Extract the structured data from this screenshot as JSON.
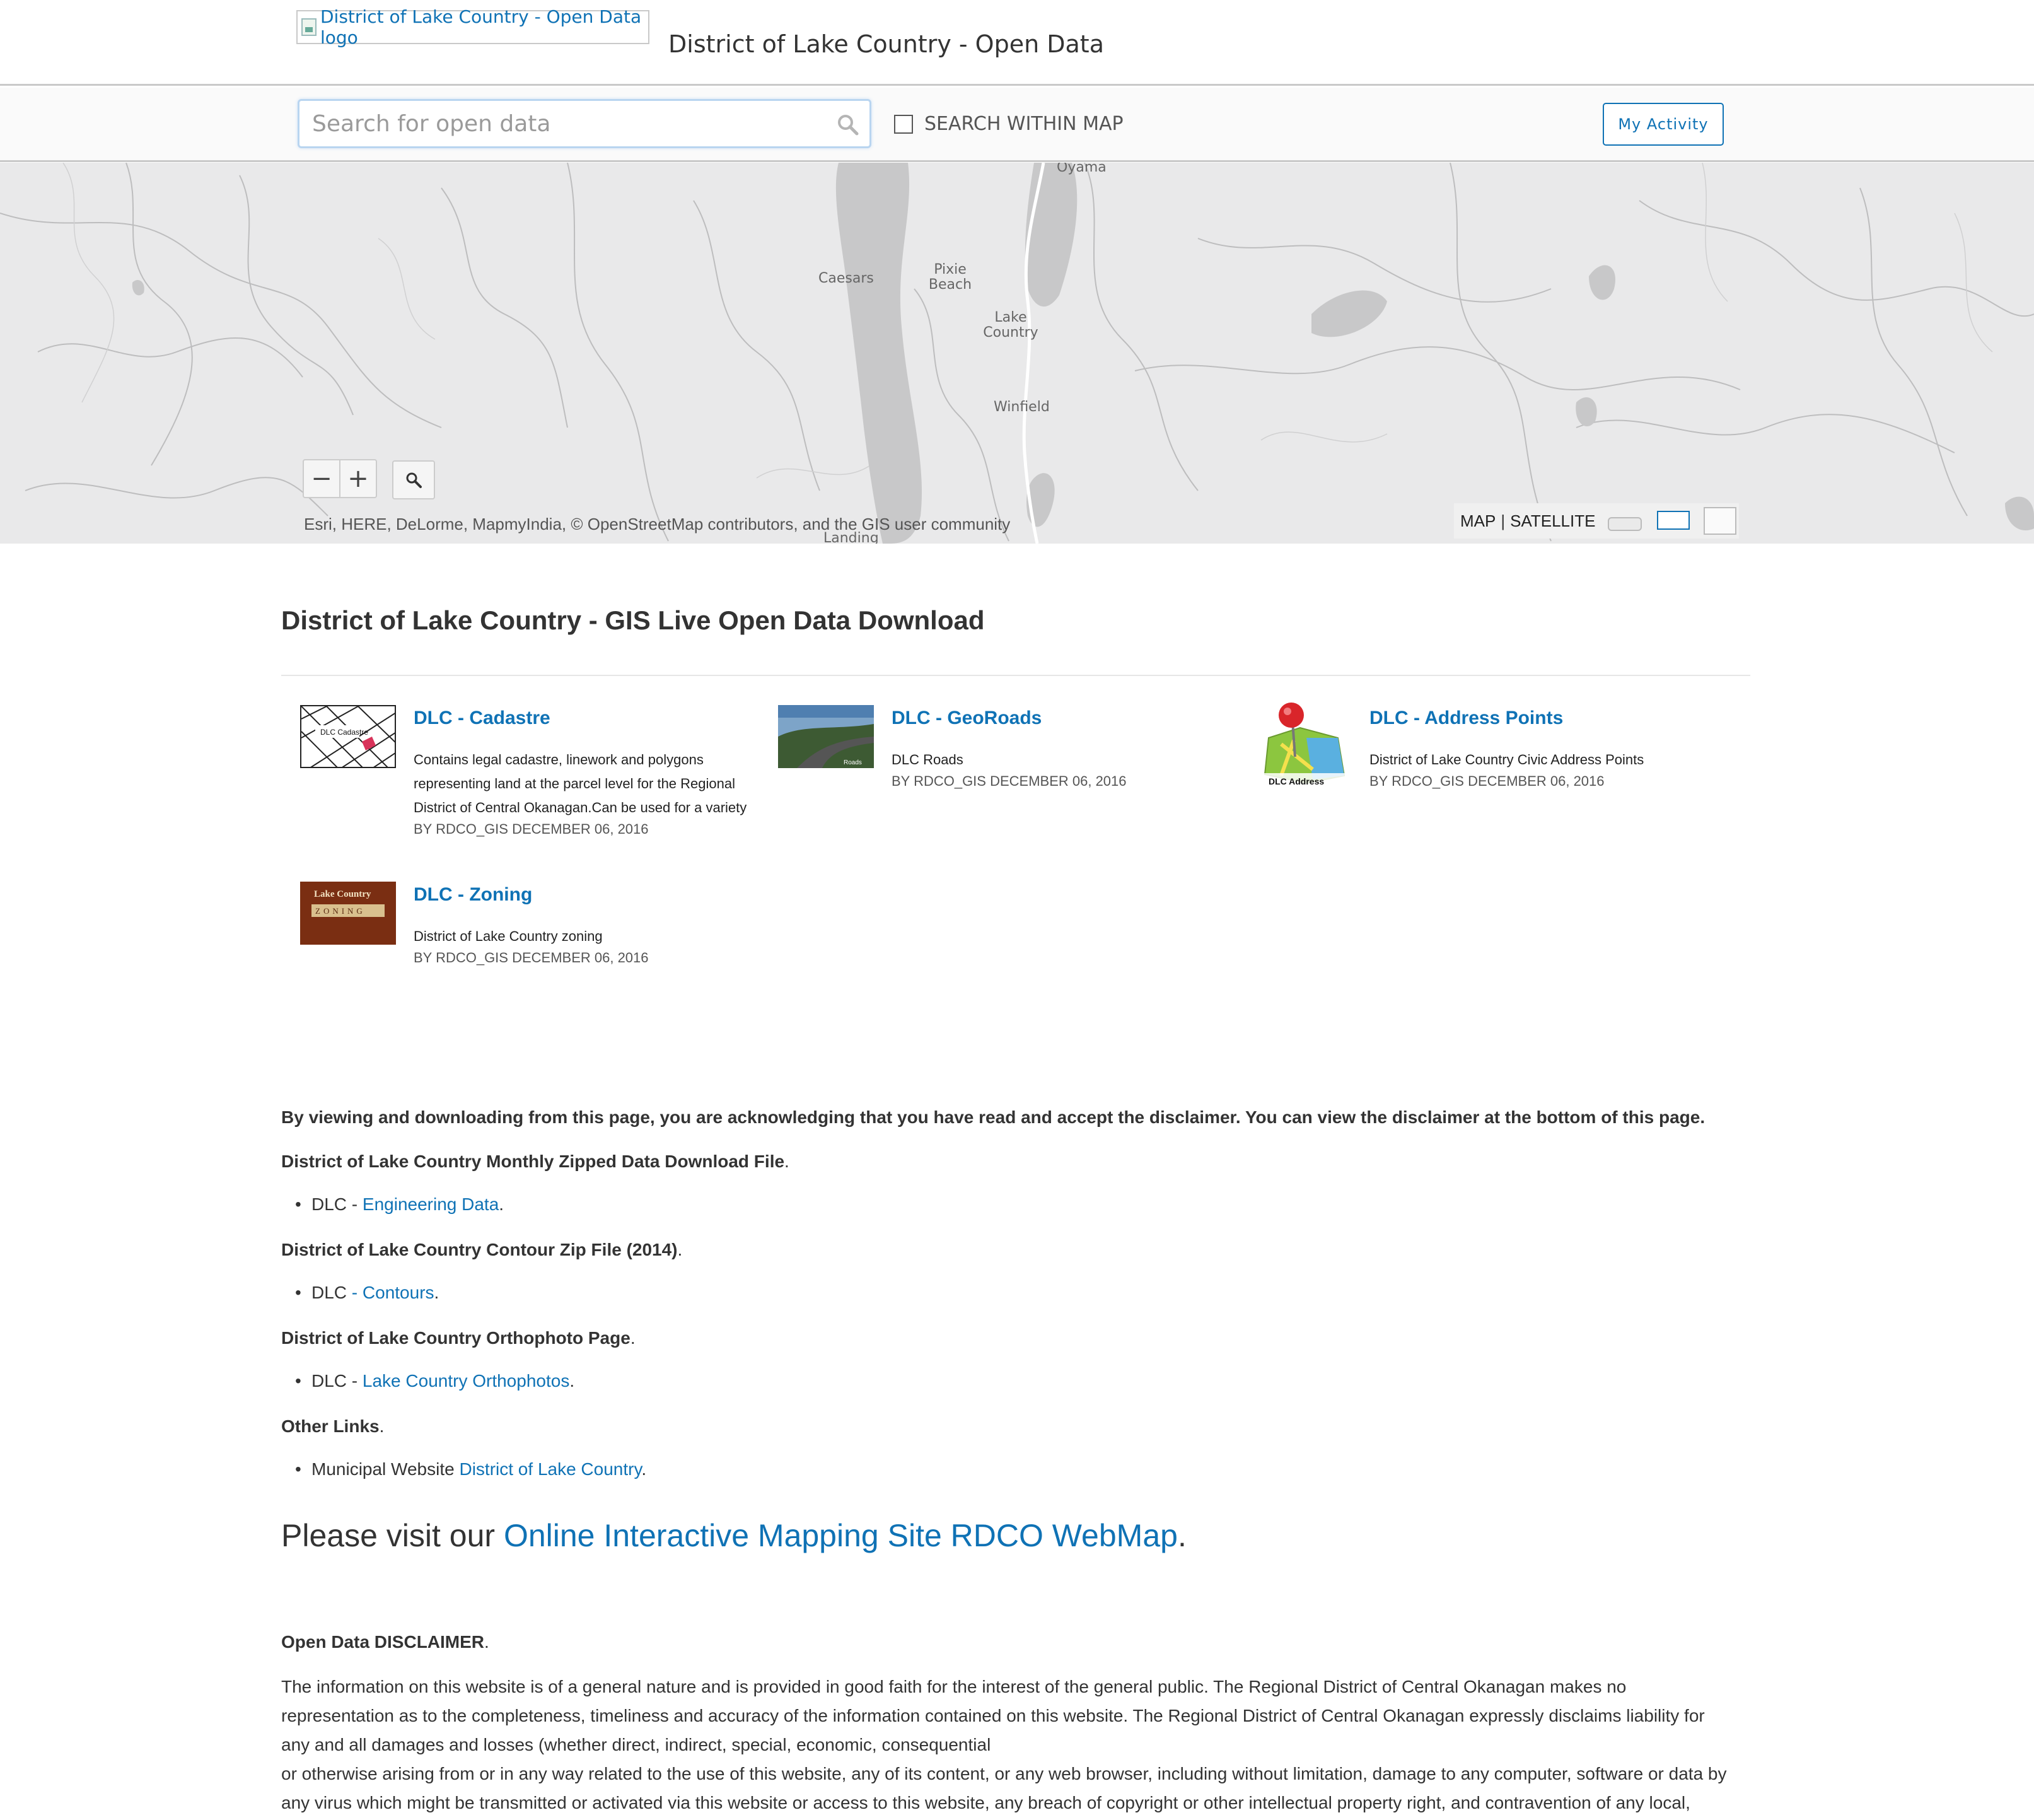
{
  "header": {
    "logo_alt": "District of Lake Country - Open Data logo",
    "site_title": "District of Lake Country - Open Data"
  },
  "search": {
    "placeholder": "Search for open data",
    "within_map_label": "SEARCH WITHIN MAP",
    "my_activity_label": "My Activity"
  },
  "map": {
    "places": {
      "oyama": "Oyama",
      "caesars": "Caesars",
      "pixie_beach": "Pixie Beach",
      "lake_country": "Lake Country",
      "winfield": "Winfield",
      "landing": "Landing"
    },
    "zoom_out": "−",
    "zoom_in": "+",
    "attribution": "Esri, HERE, DeLorme, MapmyIndia, © OpenStreetMap contributors, and the GIS user community",
    "basemap_map": "MAP",
    "basemap_separator": "|",
    "basemap_satellite": "SATELLITE"
  },
  "page_heading": "District of Lake Country - GIS Live Open Data Download",
  "datasets": [
    {
      "title": "DLC - Cadastre",
      "description": "Contains legal cadastre, linework and polygons representing land at the parcel level for the Regional District of Central Okanagan.Can be used for a variety",
      "meta": "BY RDCO_GIS DECEMBER 06, 2016",
      "thumb_label": "DLC Cadastre"
    },
    {
      "title": "DLC - GeoRoads",
      "description": "DLC Roads",
      "meta": "BY RDCO_GIS DECEMBER 06, 2016",
      "thumb_label": "Roads"
    },
    {
      "title": "DLC - Address Points",
      "description": "District of Lake Country Civic Address Points",
      "meta": "BY RDCO_GIS DECEMBER 06, 2016",
      "thumb_label": "DLC Address"
    },
    {
      "title": "DLC - Zoning",
      "description": "District of Lake Country zoning",
      "meta": "BY RDCO_GIS DECEMBER 06, 2016",
      "thumb_label_top": "Lake Country",
      "thumb_label_bottom": "ZONING"
    }
  ],
  "notice": "By viewing and downloading from this page, you are acknowledging that you have read and accept the disclaimer. You can view the disclaimer at the bottom of this page.",
  "sections": [
    {
      "heading": "District of Lake Country Monthly Zipped Data Download File",
      "prefix": "DLC - ",
      "link": "Engineering Data"
    },
    {
      "heading": "District of Lake Country Contour Zip File (2014)",
      "prefix": "DLC ",
      "link": "- Contours"
    },
    {
      "heading": "District of Lake Country Orthophoto Page",
      "prefix": "DLC - ",
      "link": "Lake Country Orthophotos"
    },
    {
      "heading": "Other Links",
      "prefix": "Municipal Website ",
      "link": "District of Lake Country"
    }
  ],
  "period": ".",
  "visit": {
    "prefix": "Please visit our ",
    "link": "Online Interactive Mapping Site RDCO WebMap"
  },
  "disclaimer": {
    "heading": "Open Data DISCLAIMER",
    "line1": "The information on this website is of a general nature and is provided in good faith for the interest of the general public. The Regional District of Central Okanagan makes no representation as to the completeness, timeliness and accuracy of the information contained on this website. The Regional District of Central Okanagan expressly disclaims liability for any and all damages and losses (whether direct, indirect, special, economic, consequential",
    "line2": "or otherwise arising from or in any way related to the use of this website, any of its content, or any web browser, including without limitation, damage to any computer, software or data by any virus which might be transmitted or activated via this website or access to this website, any breach of copyright or other intellectual property right, and contravention of any local,"
  },
  "colors": {
    "link": "#0f72b5",
    "map_land": "#e9e9ea",
    "map_water": "#c8c8c9",
    "map_river": "#bdbdbe"
  }
}
